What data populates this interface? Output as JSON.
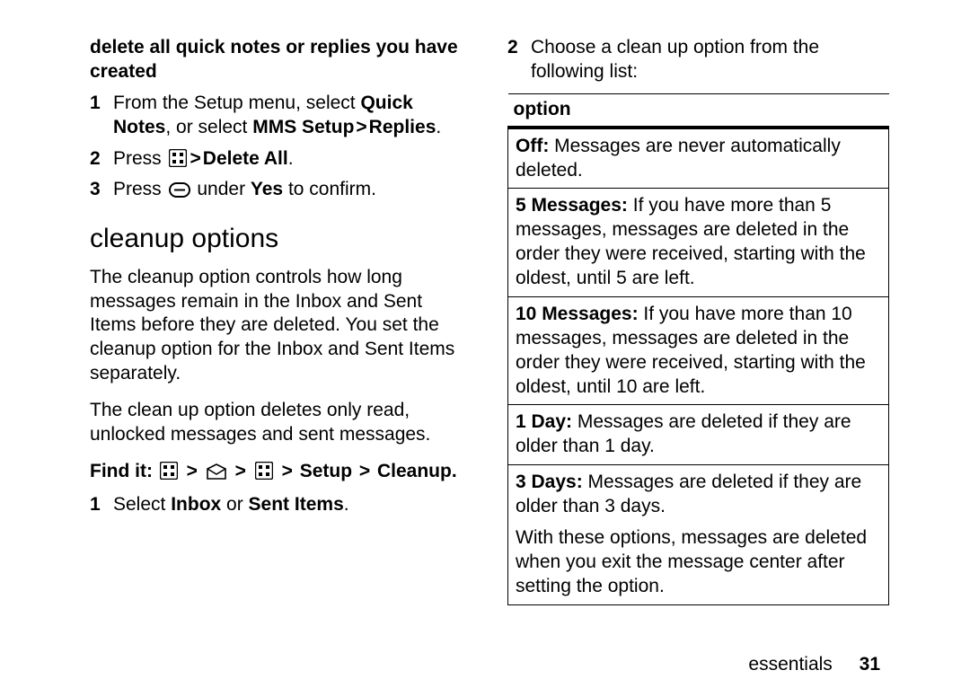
{
  "left": {
    "sec_title": "delete all quick notes or replies you have created",
    "steps_a": {
      "s1_a": "From the Setup menu, select ",
      "s1_b": "Quick Notes",
      "s1_c": ", or select ",
      "s1_d": "MMS Setup",
      "s1_e": "Replies",
      "s2_a": "Press ",
      "s2_b": "Delete All",
      "s3_a": "Press ",
      "s3_b": " under ",
      "s3_c": "Yes",
      "s3_d": " to confirm."
    },
    "h2": "cleanup options",
    "p1": "The cleanup option controls how long messages remain in the Inbox and Sent Items before they are deleted. You set the cleanup option for the Inbox and Sent Items separately.",
    "p2": "The clean up option deletes only read, unlocked messages and sent messages.",
    "findit_label": "Find it:",
    "findit_setup": "Setup",
    "findit_cleanup": "Cleanup",
    "steps_b": {
      "s1_a": "Select ",
      "s1_b": "Inbox",
      "s1_c": " or ",
      "s1_d": "Sent Items"
    }
  },
  "right": {
    "s2": "Choose a clean up option from the following list:",
    "th": "option",
    "rows": {
      "r1_b": "Off:",
      "r1_t": " Messages are never automatically deleted.",
      "r2_b": "5 Messages:",
      "r2_t": " If you have more than 5 messages, messages are deleted in the order they were received, starting with the oldest, until 5 are left.",
      "r3_b": "10 Messages:",
      "r3_t": " If you have more than 10 messages, messages are deleted in the order they were received, starting with the oldest, until 10 are left.",
      "r4_b": "1 Day:",
      "r4_t": " Messages are deleted if they are older than 1 day.",
      "r5_b": "3 Days:",
      "r5_t": " Messages are deleted if they are older than 3 days.",
      "note": "With these options, messages are deleted when you exit the message center after setting the option."
    }
  },
  "footer": {
    "section": "essentials",
    "page": "31"
  },
  "glyphs": {
    "gt": ">",
    "period": "."
  }
}
